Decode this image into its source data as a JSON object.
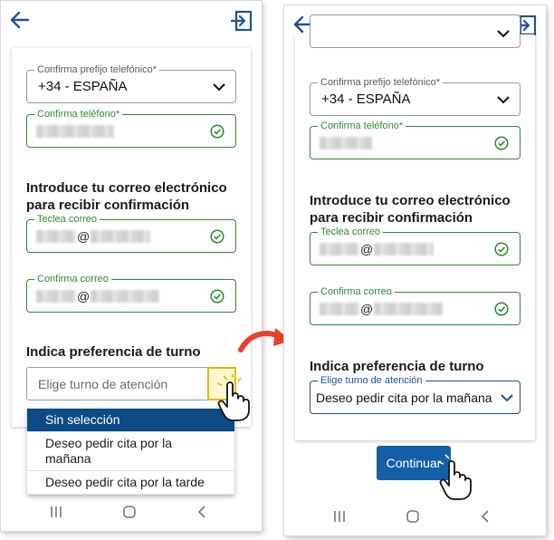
{
  "icons": {
    "back": "back-arrow-icon",
    "exit": "exit-icon",
    "check": "check-circle-icon",
    "chevron": "chevron-down-icon",
    "hand": "pointing-hand-icon",
    "nav_recents": "recents-icon",
    "nav_home": "home-icon",
    "nav_back": "back-icon",
    "transition": "curved-arrow-icon"
  },
  "colors": {
    "primary": "#1d4f9c",
    "valid": "#2e8b2e",
    "selected_option": "#0d4a86",
    "button": "#1460a8",
    "highlight": "#e6b800",
    "arrow": "#e8412a"
  },
  "left": {
    "phone_prefix": {
      "label": "Confirma prefijo telefónico*",
      "value": "+34 - ESPAÑA"
    },
    "phone_confirm": {
      "label": "Confirma teléfono*"
    },
    "email_section_title_1": "Introduce tu correo electrónico",
    "email_section_title_2": "para recibir confirmación",
    "email": {
      "label": "Teclea correo",
      "at": "@"
    },
    "email_confirm": {
      "label": "Confirma correo",
      "at": "@"
    },
    "shift_title": "Indica preferencia de turno",
    "shift_select": {
      "placeholder": "Elige turno de atención"
    },
    "dropdown_options": [
      "Sin selección",
      "Deseo pedir cita por la mañana",
      "Deseo pedir cita por la tarde"
    ]
  },
  "right": {
    "phone_prefix": {
      "label": "Confirma prefijo telefónico*",
      "value": "+34 - ESPAÑA"
    },
    "phone_confirm": {
      "label": "Confirma teléfono*"
    },
    "email_section_title_1": "Introduce tu correo electrónico",
    "email_section_title_2": "para recibir confirmación",
    "email": {
      "label": "Teclea correo",
      "at": "@"
    },
    "email_confirm": {
      "label": "Confirma correo",
      "at": "@"
    },
    "shift_title": "Indica preferencia de turno",
    "shift_select": {
      "label": "Elige turno de atención",
      "value": "Deseo pedir cita por la mañana"
    },
    "continue_label": "Continuar"
  }
}
